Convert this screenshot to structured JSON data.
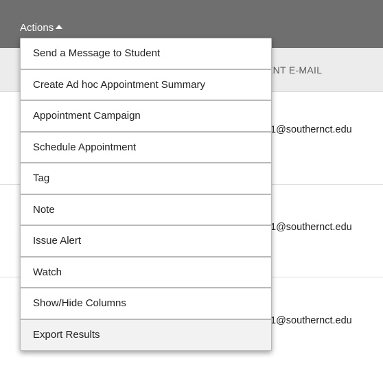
{
  "toolbar": {
    "actions_label": "Actions"
  },
  "table": {
    "column_header": "ENT E-MAIL",
    "rows": [
      {
        "email": "1@southernct.edu"
      },
      {
        "email": "1@southernct.edu"
      },
      {
        "email": "1@southernct.edu"
      }
    ]
  },
  "menu": {
    "items": [
      {
        "label": "Send a Message to Student"
      },
      {
        "label": "Create Ad hoc Appointment Summary"
      },
      {
        "label": "Appointment Campaign"
      },
      {
        "label": "Schedule Appointment"
      },
      {
        "label": "Tag"
      },
      {
        "label": "Note"
      },
      {
        "label": "Issue Alert"
      },
      {
        "label": "Watch"
      },
      {
        "label": "Show/Hide Columns"
      },
      {
        "label": "Export Results"
      }
    ]
  },
  "colors": {
    "toolbar_bg": "#6f6f6f",
    "header_bg": "#ececec",
    "menu_border": "#b9b9b9",
    "menu_highlight": "#f2f2f2"
  },
  "icons": {
    "actions_caret": "caret-up-icon"
  }
}
